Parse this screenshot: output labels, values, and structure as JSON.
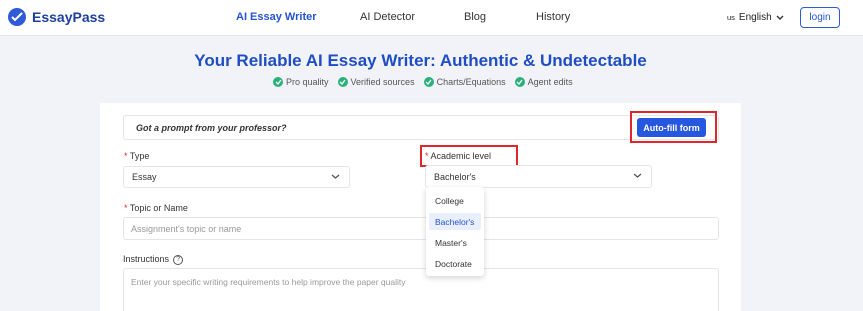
{
  "header": {
    "logo_text": "EssayPass",
    "nav": [
      {
        "label": "AI Essay Writer",
        "active": true
      },
      {
        "label": "AI Detector",
        "active": false
      },
      {
        "label": "Blog",
        "active": false
      },
      {
        "label": "History",
        "active": false
      }
    ],
    "language": {
      "country_code": "us",
      "label": "English"
    },
    "login_label": "login"
  },
  "hero": {
    "title": "Your Reliable AI Essay Writer: Authentic & Undetectable",
    "features": [
      "Pro quality",
      "Verified sources",
      "Charts/Equations",
      "Agent edits"
    ]
  },
  "form": {
    "prompt_question": "Got a prompt from your professor?",
    "autofill_label": "Auto-fill form",
    "required_mark": "*",
    "type": {
      "label": "Type",
      "value": "Essay"
    },
    "academic_level": {
      "label": "Academic level",
      "value": "Bachelor's",
      "options": [
        "College",
        "Bachelor's",
        "Master's",
        "Doctorate"
      ],
      "selected_option": "Bachelor's"
    },
    "topic": {
      "label": "Topic or Name",
      "placeholder": "Assignment's topic or name"
    },
    "instructions": {
      "label": "Instructions",
      "placeholder": "Enter your specific writing requirements to help improve the paper quality"
    }
  },
  "colors": {
    "accent": "#2557e0",
    "highlight_border": "#e0262b",
    "check_green": "#2bb07a"
  }
}
